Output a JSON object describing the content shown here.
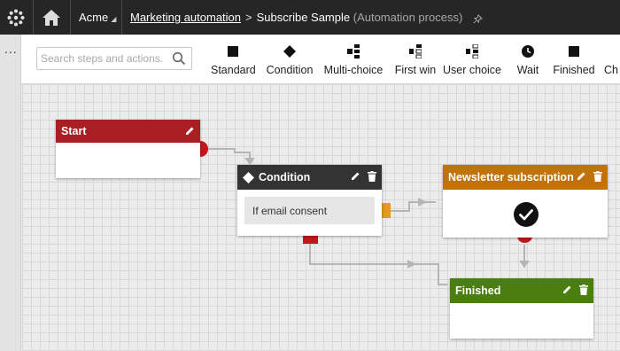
{
  "header": {
    "site": "Acme",
    "breadcrumb_link": "Marketing automation",
    "breadcrumb_separator": ">",
    "page_title": "Subscribe Sample",
    "page_subtitle": "(Automation process)"
  },
  "toolbar": {
    "search_placeholder": "Search steps and actions.",
    "tools": [
      {
        "label": "Standard",
        "icon": "square-icon"
      },
      {
        "label": "Condition",
        "icon": "diamond-icon"
      },
      {
        "label": "Multi-choice",
        "icon": "multi-choice-icon"
      },
      {
        "label": "First win",
        "icon": "first-win-icon"
      },
      {
        "label": "User choice",
        "icon": "user-choice-icon"
      },
      {
        "label": "Wait",
        "icon": "clock-icon"
      },
      {
        "label": "Finished",
        "icon": "square-icon"
      },
      {
        "label": "Ch",
        "icon": ""
      }
    ]
  },
  "rail": {
    "more": "..."
  },
  "workflow": {
    "start": {
      "title": "Start",
      "color": "#a91e22"
    },
    "condition": {
      "title": "Condition",
      "rule": "If email consent",
      "color": "#333333"
    },
    "newsletter": {
      "title": "Newsletter subscription",
      "color": "#c0720b"
    },
    "finished": {
      "title": "Finished",
      "color": "#4a7f0f"
    }
  },
  "colors": {
    "topbar": "#262626",
    "port_red": "#c4161c",
    "port_orange": "#e39a1d",
    "connector": "#b5b5b5"
  }
}
